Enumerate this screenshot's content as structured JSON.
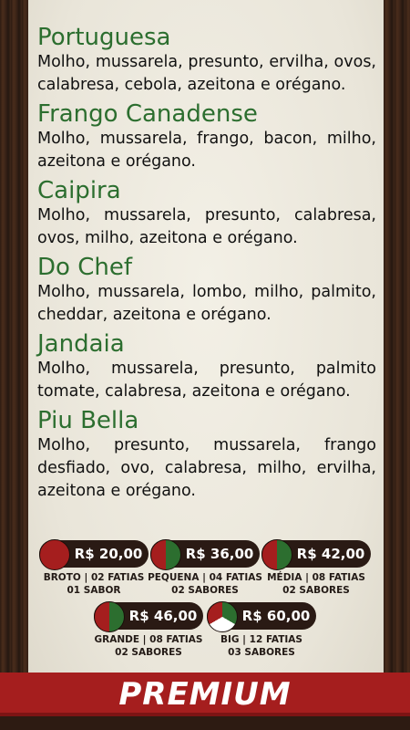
{
  "menu": {
    "items": [
      {
        "name": "Portuguesa",
        "desc": "Molho, mussarela, presunto, ervilha, ovos, calabresa, cebola, azeitona e orégano."
      },
      {
        "name": "Frango Canadense",
        "desc": "Molho, mussarela, frango, bacon, milho, azeitona e orégano."
      },
      {
        "name": "Caipira",
        "desc": "Molho, mussarela, presunto, calabresa, ovos, milho, azeitona e orégano."
      },
      {
        "name": "Do Chef",
        "desc": "Molho, mussarela, lombo, milho, palmito, cheddar, azeitona e orégano."
      },
      {
        "name": "Jandaia",
        "desc": "Molho, mussarela, presunto, palmito tomate, calabresa, azeitona e orégano."
      },
      {
        "name": "Piu Bella",
        "desc": "Molho, presunto, mussarela, frango desfiado, ovo, calabresa, milho, ervilha, azeitona e orégano."
      }
    ]
  },
  "prices": [
    {
      "amount": "R$ 20,00",
      "size": "BROTO | 02 FATIAS",
      "flavors": "01 SABOR"
    },
    {
      "amount": "R$ 36,00",
      "size": "PEQUENA | 04 FATIAS",
      "flavors": "02 SABORES"
    },
    {
      "amount": "R$ 42,00",
      "size": "MÉDIA | 08 FATIAS",
      "flavors": "02 SABORES"
    },
    {
      "amount": "R$ 46,00",
      "size": "GRANDE | 08 FATIAS",
      "flavors": "02 SABORES"
    },
    {
      "amount": "R$ 60,00",
      "size": "BIG | 12 FATIAS",
      "flavors": "03 SABORES"
    }
  ],
  "banner": {
    "label": "PREMIUM"
  },
  "colors": {
    "green": "#2c6e2f",
    "red": "#a51e1e",
    "dark": "#2a1a14"
  }
}
